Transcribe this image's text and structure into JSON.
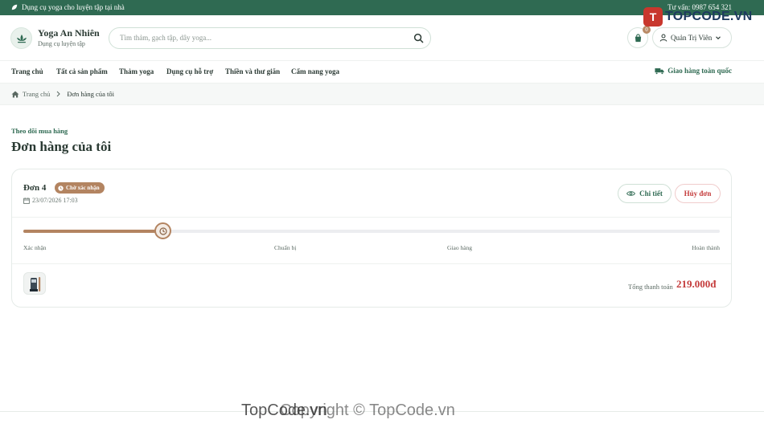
{
  "topbar": {
    "tagline": "Dụng cụ yoga cho luyện tập tại nhà",
    "hotline": "Tư vấn: 0987 654 321"
  },
  "brand": {
    "name": "Yoga An Nhiên",
    "subtitle": "Dụng cụ luyện tập"
  },
  "search": {
    "placeholder": "Tìm thảm, gạch tập, dây yoga..."
  },
  "cart": {
    "count": "0"
  },
  "user": {
    "name": "Quản Trị Viên"
  },
  "nav": {
    "items": [
      "Trang chủ",
      "Tất cả sản phẩm",
      "Thảm yoga",
      "Dụng cụ hỗ trợ",
      "Thiền và thư giãn",
      "Cẩm nang yoga"
    ],
    "shipping": "Giao hàng toàn quốc"
  },
  "breadcrumb": {
    "home": "Trang chủ",
    "current": "Đơn hàng của tôi"
  },
  "page": {
    "eyebrow": "Theo dõi mua hàng",
    "title": "Đơn hàng của tôi"
  },
  "order": {
    "name": "Đơn 4",
    "status": "Chờ xác nhận",
    "date": "23/07/2026 17:03",
    "detail_label": "Chi tiết",
    "cancel_label": "Hủy đơn",
    "progress": 0.2,
    "steps": [
      "Xác nhận",
      "Chuẩn bị",
      "Giao hàng",
      "Hoàn thành"
    ],
    "total_label": "Tổng thanh toán",
    "total_value": "219.000đ"
  },
  "watermark": {
    "top": "TOPCODE.VN",
    "bottom": "TopCode.vn",
    "bottom_overlay": "Copyright © TopCode.vn"
  },
  "colors": {
    "primary": "#2f6a52",
    "accent": "#b38461",
    "danger": "#c43b3b"
  }
}
